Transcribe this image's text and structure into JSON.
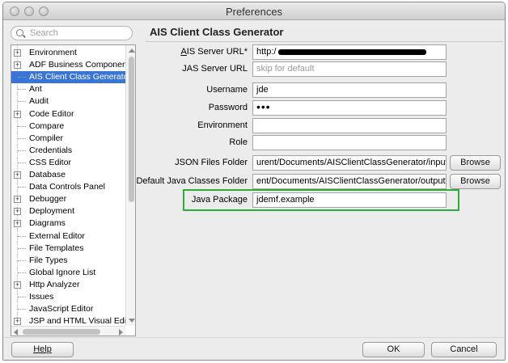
{
  "window": {
    "title": "Preferences"
  },
  "search": {
    "placeholder": "Search"
  },
  "tree": {
    "items": [
      {
        "label": "Environment",
        "expandable": true,
        "selected": false
      },
      {
        "label": "ADF Business Componen",
        "expandable": true,
        "selected": false
      },
      {
        "label": "AIS Client Class Generato",
        "expandable": false,
        "selected": true
      },
      {
        "label": "Ant",
        "expandable": false,
        "selected": false
      },
      {
        "label": "Audit",
        "expandable": false,
        "selected": false
      },
      {
        "label": "Code Editor",
        "expandable": true,
        "selected": false
      },
      {
        "label": "Compare",
        "expandable": false,
        "selected": false
      },
      {
        "label": "Compiler",
        "expandable": false,
        "selected": false
      },
      {
        "label": "Credentials",
        "expandable": false,
        "selected": false
      },
      {
        "label": "CSS Editor",
        "expandable": false,
        "selected": false
      },
      {
        "label": "Database",
        "expandable": true,
        "selected": false
      },
      {
        "label": "Data Controls Panel",
        "expandable": false,
        "selected": false
      },
      {
        "label": "Debugger",
        "expandable": true,
        "selected": false
      },
      {
        "label": "Deployment",
        "expandable": true,
        "selected": false
      },
      {
        "label": "Diagrams",
        "expandable": true,
        "selected": false
      },
      {
        "label": "External Editor",
        "expandable": false,
        "selected": false
      },
      {
        "label": "File Templates",
        "expandable": false,
        "selected": false
      },
      {
        "label": "File Types",
        "expandable": false,
        "selected": false
      },
      {
        "label": "Global Ignore List",
        "expandable": false,
        "selected": false
      },
      {
        "label": "Http Analyzer",
        "expandable": true,
        "selected": false
      },
      {
        "label": "Issues",
        "expandable": false,
        "selected": false
      },
      {
        "label": "JavaScript Editor",
        "expandable": false,
        "selected": false
      },
      {
        "label": "JSP and HTML Visual Edit",
        "expandable": true,
        "selected": false
      }
    ]
  },
  "panel": {
    "title": "AIS Client Class Generator",
    "fields": {
      "ais_server_url": {
        "label": "AIS Server URL*",
        "value": "http:/"
      },
      "jas_server_url": {
        "label": "JAS Server URL",
        "placeholder": "skip for default"
      },
      "username": {
        "label": "Username",
        "value": "jde"
      },
      "password": {
        "label": "Password",
        "value": "•••"
      },
      "environment": {
        "label": "Environment",
        "value": ""
      },
      "role": {
        "label": "Role",
        "value": ""
      },
      "json_files_folder": {
        "label": "JSON Files Folder",
        "value": "urent/Documents/AISClientClassGenerator/input"
      },
      "default_java_classes_folder": {
        "label": "Default Java Classes Folder",
        "value": "ent/Documents/AISClientClassGenerator/output"
      },
      "java_package": {
        "label": "Java Package",
        "value": "jdemf.example"
      }
    },
    "browse_label": "Browse",
    "highlight_color": "#2eac3a"
  },
  "footer": {
    "help_label": "Help",
    "ok_label": "OK",
    "cancel_label": "Cancel"
  },
  "colors": {
    "selection": "#3875d7",
    "window_bg": "#ececec"
  }
}
